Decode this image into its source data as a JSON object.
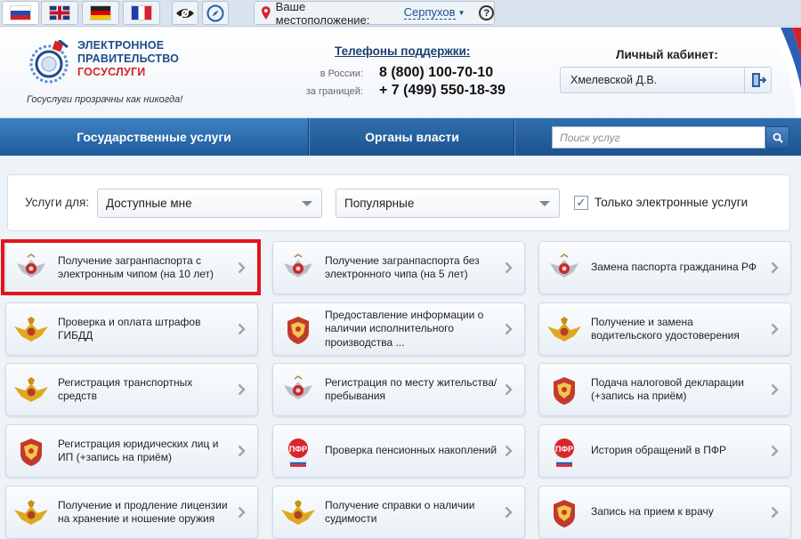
{
  "topbar": {
    "languages": [
      {
        "name": "ru",
        "icon": "russia-flag-icon",
        "active": true
      },
      {
        "name": "en",
        "icon": "uk-flag-icon",
        "active": false
      },
      {
        "name": "de",
        "icon": "germany-flag-icon",
        "active": false
      },
      {
        "name": "fr",
        "icon": "france-flag-icon",
        "active": false
      }
    ],
    "accessibility_icon": "eye-icon",
    "navigation_icon": "compass-icon",
    "location_label": "Ваше местоположение:",
    "location_city": "Серпухов",
    "help_icon": "question-icon"
  },
  "header": {
    "logo_line1": "ЭЛЕКТРОННОЕ",
    "logo_line2": "ПРАВИТЕЛЬСТВО",
    "logo_line3": "ГОСУСЛУГИ",
    "slogan": "Госуслуги прозрачны как никогда!",
    "phones_title": "Телефоны поддержки",
    "phone_ru_label": "в России:",
    "phone_ru": "8 (800) 100-70-10",
    "phone_abroad_label": "за границей:",
    "phone_abroad": "+ 7 (499) 550-18-39",
    "cabinet_title": "Личный кабинет:",
    "cabinet_user": "Хмелевской Д.В."
  },
  "nav": {
    "tab1": "Государственные услуги",
    "tab2": "Органы власти",
    "search_placeholder": "Поиск услуг"
  },
  "filter": {
    "label": "Услуги для:",
    "audience": "Доступные мне",
    "sort": "Популярные",
    "electronic_only": "Только электронные услуги",
    "electronic_only_checked": true
  },
  "services": [
    {
      "title": "Получение загранпаспорта с электронным чипом (на 10 лет)",
      "icon": "eagle-emblem-icon"
    },
    {
      "title": "Получение загранпаспорта без электронного чипа (на 5 лет)",
      "icon": "eagle-emblem-icon"
    },
    {
      "title": "Замена паспорта гражданина РФ",
      "icon": "eagle-emblem-icon"
    },
    {
      "title": "Проверка и оплата штрафов ГИБДД",
      "icon": "gold-eagle-icon"
    },
    {
      "title": "Предоставление информации о наличии исполнительного производства ...",
      "icon": "coat-of-arms-icon"
    },
    {
      "title": "Получение и замена водительского удостоверения",
      "icon": "gold-eagle-icon"
    },
    {
      "title": "Регистрация транспортных средств",
      "icon": "gold-eagle-icon"
    },
    {
      "title": "Регистрация по месту жительства/ пребывания",
      "icon": "eagle-emblem-icon"
    },
    {
      "title": "Подача налоговой декларации (+запись на приём)",
      "icon": "coat-of-arms-icon"
    },
    {
      "title": "Регистрация юридических лиц и ИП (+запись на приём)",
      "icon": "coat-of-arms-icon"
    },
    {
      "title": "Проверка пенсионных накоплений",
      "icon": "pfr-logo-icon"
    },
    {
      "title": "История обращений в ПФР",
      "icon": "pfr-logo-icon"
    },
    {
      "title": "Получение и продление лицензии на хранение и ношение оружия",
      "icon": "gold-eagle-icon"
    },
    {
      "title": "Получение справки о наличии судимости",
      "icon": "gold-eagle-icon"
    },
    {
      "title": "Запись на прием к врачу",
      "icon": "coat-of-arms-icon"
    }
  ],
  "colors": {
    "nav_blue": "#1d528d",
    "brand_blue": "#1c4d8c",
    "brand_red": "#d4242a",
    "highlight": "#e3141c"
  }
}
